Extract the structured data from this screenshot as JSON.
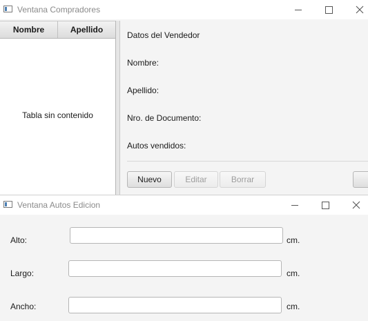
{
  "window1": {
    "title": "Ventana Compradores",
    "table": {
      "columns": [
        "Nombre",
        "Apellido"
      ],
      "placeholder": "Tabla sin contenido"
    },
    "details": {
      "heading": "Datos del Vendedor",
      "labels": [
        "Nombre:",
        "Apellido:",
        "Nro. de Documento:",
        "Autos vendidos:"
      ]
    },
    "buttons": {
      "new": "Nuevo",
      "edit": "Editar",
      "delete": "Borrar"
    }
  },
  "window2": {
    "title": "Ventana Autos Edicion",
    "fields": [
      {
        "label": "Alto:",
        "value": "",
        "unit": "cm."
      },
      {
        "label": "Largo:",
        "value": "",
        "unit": "cm."
      },
      {
        "label": "Ancho:",
        "value": "",
        "unit": "cm."
      }
    ]
  }
}
